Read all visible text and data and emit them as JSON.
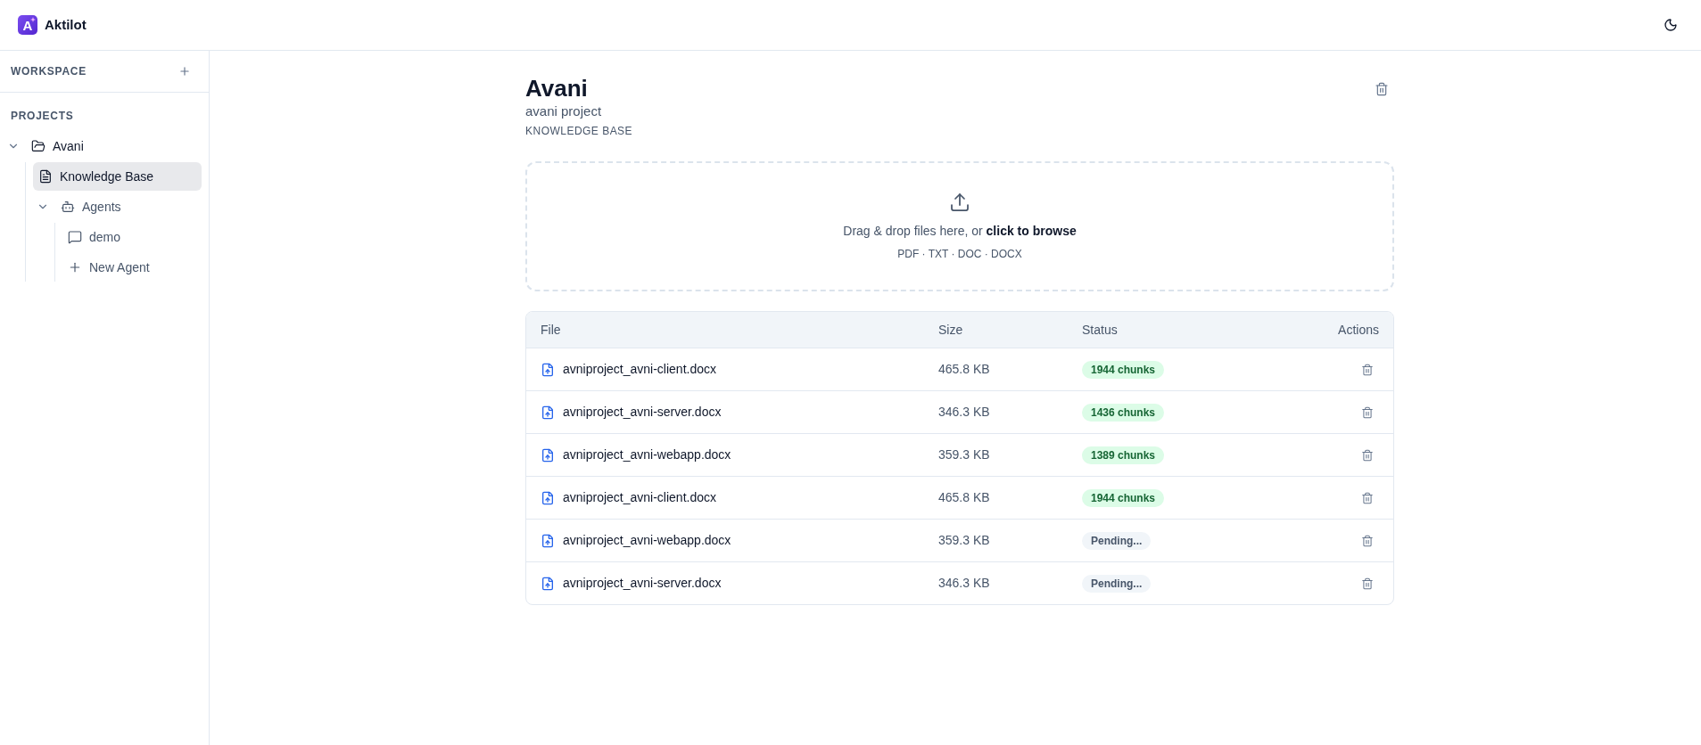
{
  "app": {
    "logo_letter": "A",
    "name": "Aktilot"
  },
  "sidebar": {
    "workspace_label": "WORKSPACE",
    "projects_label": "PROJECTS",
    "tree": [
      {
        "kind": "folder",
        "label": "Avani",
        "selected": false,
        "expanded": true,
        "children": [
          {
            "kind": "document",
            "label": "Knowledge Base",
            "selected": true
          },
          {
            "kind": "agents",
            "label": "Agents",
            "selected": false,
            "expanded": true,
            "children": [
              {
                "kind": "chat",
                "label": "demo",
                "selected": false
              },
              {
                "kind": "add",
                "label": "New Agent",
                "selected": false
              }
            ]
          }
        ]
      }
    ]
  },
  "page": {
    "title": "Avani",
    "subtitle": "avani project",
    "section": "KNOWLEDGE BASE"
  },
  "dropzone": {
    "text": "Drag & drop files here, or **click to browse**",
    "formats": "PDF · TXT · DOC · DOCX"
  },
  "table": {
    "columns": [
      "File",
      "Size",
      "Status",
      "Actions"
    ],
    "rows": [
      {
        "file": "avniproject_avni-client.docx",
        "size": "465.8 KB",
        "status": {
          "kind": "ready",
          "label": "1944 chunks"
        }
      },
      {
        "file": "avniproject_avni-server.docx",
        "size": "346.3 KB",
        "status": {
          "kind": "ready",
          "label": "1436 chunks"
        }
      },
      {
        "file": "avniproject_avni-webapp.docx",
        "size": "359.3 KB",
        "status": {
          "kind": "ready",
          "label": "1389 chunks"
        }
      },
      {
        "file": "avniproject_avni-client.docx",
        "size": "465.8 KB",
        "status": {
          "kind": "ready",
          "label": "1944 chunks"
        }
      },
      {
        "file": "avniproject_avni-webapp.docx",
        "size": "359.3 KB",
        "status": {
          "kind": "pending",
          "label": "Pending..."
        }
      },
      {
        "file": "avniproject_avni-server.docx",
        "size": "346.3 KB",
        "status": {
          "kind": "pending",
          "label": "Pending..."
        }
      }
    ]
  }
}
